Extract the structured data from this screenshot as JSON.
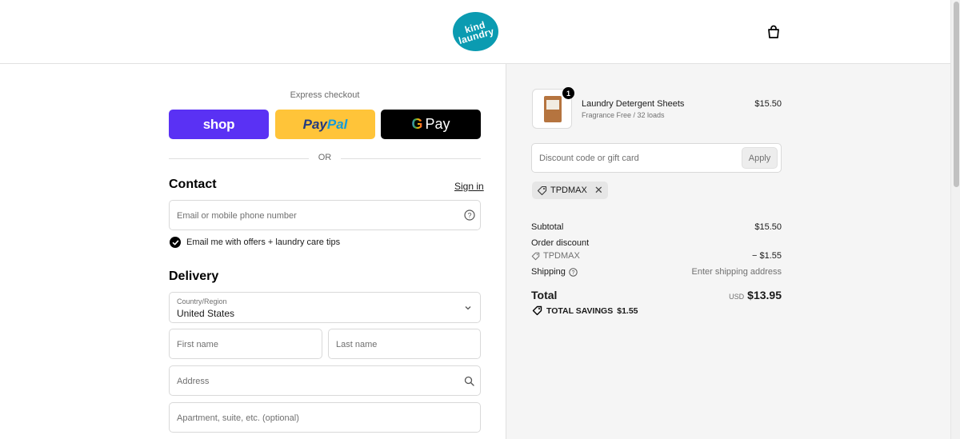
{
  "header": {
    "logo_line1": "kind",
    "logo_line2": "laundry"
  },
  "express": {
    "title": "Express checkout",
    "shop_label": "shop",
    "paypal_a": "Pay",
    "paypal_b": "Pal",
    "gpay_g": "G",
    "gpay_label": "Pay",
    "or_label": "OR"
  },
  "contact": {
    "heading": "Contact",
    "signin": "Sign in",
    "email_placeholder": "Email or mobile phone number",
    "marketing_label": "Email me with offers + laundry care tips",
    "marketing_checked": true
  },
  "delivery": {
    "heading": "Delivery",
    "country_label": "Country/Region",
    "country_value": "United States",
    "first_name": "First name",
    "last_name": "Last name",
    "address": "Address",
    "apartment": "Apartment, suite, etc. (optional)"
  },
  "order": {
    "product_name": "Laundry Detergent Sheets",
    "product_variant": "Fragrance Free / 32 loads",
    "product_price": "$15.50",
    "quantity": "1",
    "discount_placeholder": "Discount code or gift card",
    "apply_label": "Apply",
    "applied_code": "TPDMAX",
    "subtotal_label": "Subtotal",
    "subtotal_value": "$15.50",
    "order_discount_label": "Order discount",
    "discount_code": "TPDMAX",
    "discount_value": "− $1.55",
    "shipping_label": "Shipping",
    "shipping_value": "Enter shipping address",
    "total_label": "Total",
    "currency": "USD",
    "total_value": "$13.95",
    "savings_label": "TOTAL SAVINGS",
    "savings_value": "$1.55"
  },
  "colors": {
    "brand": "#0b9bb1",
    "shop_pay": "#5a31f4",
    "paypal": "#ffc439",
    "gpay": "#000000"
  }
}
